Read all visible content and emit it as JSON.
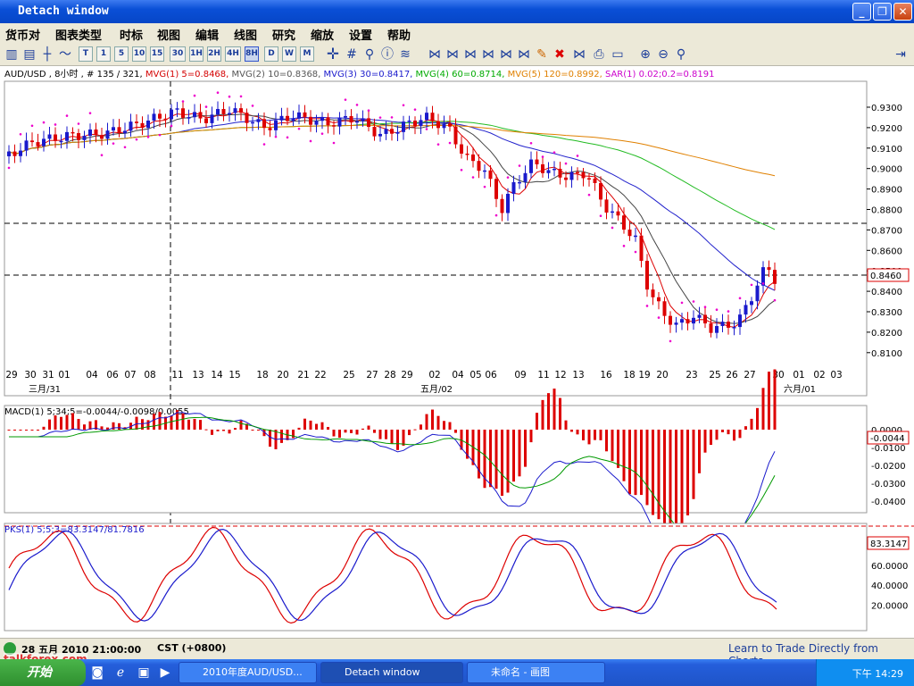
{
  "window": {
    "title": "Detach window",
    "minimize": "_",
    "restore": "❐",
    "close": "✕"
  },
  "menu": [
    "货币对",
    "图表类型",
    "时标",
    "视图",
    "编辑",
    "线图",
    "研究",
    "缩放",
    "设置",
    "帮助"
  ],
  "timeframes": [
    "T",
    "1",
    "5",
    "10",
    "15",
    "30",
    "1H",
    "2H",
    "4H",
    "8H",
    "D",
    "W",
    "M"
  ],
  "active_timeframe": "8H",
  "chart": {
    "header": [
      {
        "text": "AUD/USD , 8小时 , # 135 / 321, ",
        "color": "#000000"
      },
      {
        "text": "MVG(1) 5=0.8468, ",
        "color": "#d40000"
      },
      {
        "text": "MVG(2) 10=0.8368, ",
        "color": "#555555"
      },
      {
        "text": "MVG(3) 30=0.8417, ",
        "color": "#1a1acc"
      },
      {
        "text": "MVG(4) 60=0.8714, ",
        "color": "#00aa00"
      },
      {
        "text": "MVG(5) 120=0.8992, ",
        "color": "#e08000"
      },
      {
        "text": "SAR(1) 0.02;0.2=0.8191",
        "color": "#cc00cc"
      }
    ],
    "price_ticks": [
      "0.9300",
      "0.9200",
      "0.9100",
      "0.9000",
      "0.8900",
      "0.8800",
      "0.8700",
      "0.8600",
      "0.8500",
      "0.8400",
      "0.8300",
      "0.8200",
      "0.8100"
    ],
    "current_price": "0.8460",
    "date_ticks": [
      "29",
      "30",
      "31",
      "01",
      "04",
      "06",
      "07",
      "08",
      "11",
      "13",
      "14",
      "15",
      "18",
      "20",
      "21",
      "22",
      "25",
      "27",
      "28",
      "29",
      "02",
      "04",
      "05",
      "06",
      "09",
      "11",
      "12",
      "13",
      "16",
      "18",
      "19",
      "20",
      "23",
      "25",
      "26",
      "27",
      "30",
      "01",
      "02",
      "03"
    ],
    "months": [
      "三月/31",
      "五月/02",
      "六月/01"
    ]
  },
  "macd": {
    "label": "MACD(1) 5;34;5=-0.0044/-0.0098/0.0055",
    "ticks": [
      "0.0000",
      "-0.0100",
      "-0.0200",
      "-0.0300",
      "-0.0400"
    ],
    "current": "-0.0044"
  },
  "pks": {
    "label": "PKS(1) 5;5;3=83.3147/81.7816",
    "ticks": [
      "60.0000",
      "40.0000",
      "20.0000"
    ],
    "current": "83.3147"
  },
  "status": {
    "datetime": "28 五月 2010 21:00:00",
    "tz": "CST (+0800)",
    "link": "Learn to Trade Directly from Charts",
    "watermark": "talkforex.com"
  },
  "taskbar": {
    "start": "开始",
    "tasks": [
      "2010年度AUD/USD...",
      "Detach window",
      "未命名 - 画图"
    ],
    "clock": "下午 14:29"
  },
  "colors": {
    "bull": "#1a1acc",
    "bear": "#dd0000",
    "sar": "#ee00cc",
    "ma5": "#dd0000",
    "ma10": "#444444",
    "ma30": "#2222cc",
    "ma60": "#22bb22",
    "ma120": "#e08000",
    "macd_hist": "#dd0000",
    "macd_line": "#1a1acc",
    "signal": "#009900"
  }
}
